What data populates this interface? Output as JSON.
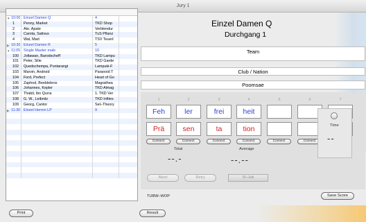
{
  "window": {
    "title": "Jury 1"
  },
  "list": {
    "rows": [
      {
        "type": "group",
        "expand": "▼",
        "c1": "10:00",
        "c2": "Einzel Damen Q",
        "c3": "4"
      },
      {
        "type": "item",
        "c1": "1",
        "c2": "Penny, Market",
        "c3": "TKD Shop"
      },
      {
        "type": "item",
        "c1": "2",
        "c2": "Ate, Apate",
        "c3": "Verblendur"
      },
      {
        "type": "item",
        "c1": "3",
        "c2": "Carota, Sativus",
        "c3": "TuS Pflanz"
      },
      {
        "type": "item",
        "c1": "4",
        "c2": "Wal, Mart",
        "c3": "TSV Teuerl"
      },
      {
        "type": "group",
        "expand": "▶",
        "c1": "10:30",
        "c2": "Einzel Damen R",
        "c3": "5"
      },
      {
        "type": "group",
        "expand": "▼",
        "c1": "11:05",
        "c2": "Single Master male",
        "c3": "10"
      },
      {
        "type": "item",
        "c1": "100",
        "c2": "Joltawan, Barodscheff",
        "c3": "TKD Lampu"
      },
      {
        "type": "item",
        "c1": "101",
        "c2": "Peter, Silie",
        "c3": "TKD Garde"
      },
      {
        "type": "item",
        "c1": "102",
        "c2": "Quedschempa, Puntarangi",
        "c3": "Lampuki-F"
      },
      {
        "type": "item",
        "c1": "103",
        "c2": "Marvin, Android",
        "c3": "Paranoid T"
      },
      {
        "type": "item",
        "c1": "104",
        "c2": "Ford, Prefect",
        "c3": "Heart of Go"
      },
      {
        "type": "item",
        "c1": "105",
        "c2": "Zaphod, Beeblebrox",
        "c3": "Magrathea"
      },
      {
        "type": "item",
        "c1": "106",
        "c2": "Johannes, Kepler",
        "c3": "TKD Almag"
      },
      {
        "type": "item",
        "c1": "107",
        "c2": "Thabit, ibn Qurra",
        "c3": "1. TKD Ver"
      },
      {
        "type": "item",
        "c1": "108",
        "c2": "G. W., Leibnitz",
        "c3": "TKD Infites"
      },
      {
        "type": "item",
        "c1": "109",
        "c2": "Georg, Cantor",
        "c3": "Set–Theory"
      },
      {
        "type": "group",
        "expand": "▶",
        "c1": "11:30",
        "c2": "Einzel Herren LP",
        "c3": "9"
      }
    ],
    "empty_rows": 12
  },
  "header": {
    "event": "Einzel Damen Q",
    "round": "Durchgang 1"
  },
  "fields": {
    "team": "Team",
    "club": "Club / Nation",
    "poomsae": "Poomsae"
  },
  "columns": [
    "1",
    "2",
    "3",
    "4",
    "5",
    "6",
    "7"
  ],
  "blue_row": [
    "Feh",
    "ler",
    "frei",
    "heit",
    "",
    "",
    ""
  ],
  "red_row": [
    "Prä",
    "sen",
    "ta",
    "tion",
    "",
    "",
    ""
  ],
  "connect_label": "Connect",
  "totals": {
    "total_label": "Total",
    "total_value": "--.-",
    "average_label": "Average",
    "average_value": "--.--"
  },
  "buttons": {
    "abort": "Abort",
    "retry": "Retry",
    "sijak": "Si–Jak",
    "save": "Save Score",
    "print": "Print",
    "result": "Result"
  },
  "time": {
    "label": "Time",
    "value": "--"
  },
  "footer": {
    "label": "TUBW–WOP"
  }
}
